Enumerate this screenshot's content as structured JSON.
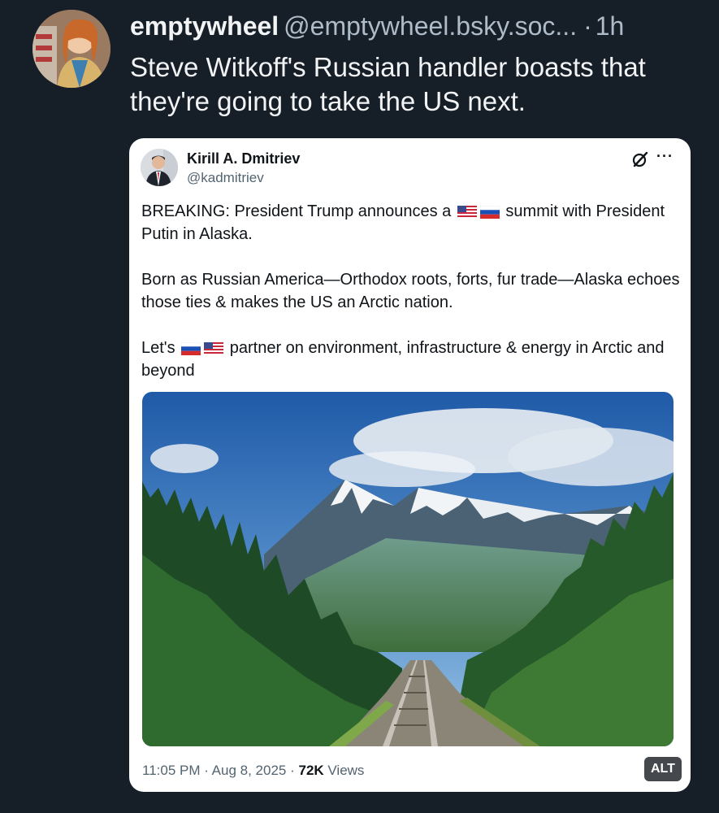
{
  "post": {
    "display_name": "emptywheel",
    "handle": "@emptywheel.bsky.soc...",
    "separator": "·",
    "time": "1h",
    "text": "Steve Witkoff's Russian handler boasts that they're going to take the US next."
  },
  "quoted": {
    "name": "Kirill A. Dmitriev",
    "handle": "@kadmitriev",
    "p1_before": "BREAKING: President Trump announces a ",
    "p1_after": " summit with President Putin in Alaska.",
    "p2": "Born as Russian America—Orthodox roots, forts, fur trade—Alaska echoes those ties & makes the US an Arctic nation.",
    "p3_before": "Let's ",
    "p3_after": " partner on environment, infrastructure & energy in Arctic and beyond",
    "datetime": "11:05 PM · Aug 8, 2025 · ",
    "views_count": "72K",
    "views_label": " Views",
    "alt_badge": "ALT"
  },
  "icons": {
    "more": "more-horizontal-icon",
    "grok": "grok-slash-icon",
    "flags": [
      "us-flag-icon",
      "russia-flag-icon"
    ]
  },
  "colors": {
    "background": "#161e27",
    "card": "#ffffff",
    "muted": "#aebbc9"
  }
}
